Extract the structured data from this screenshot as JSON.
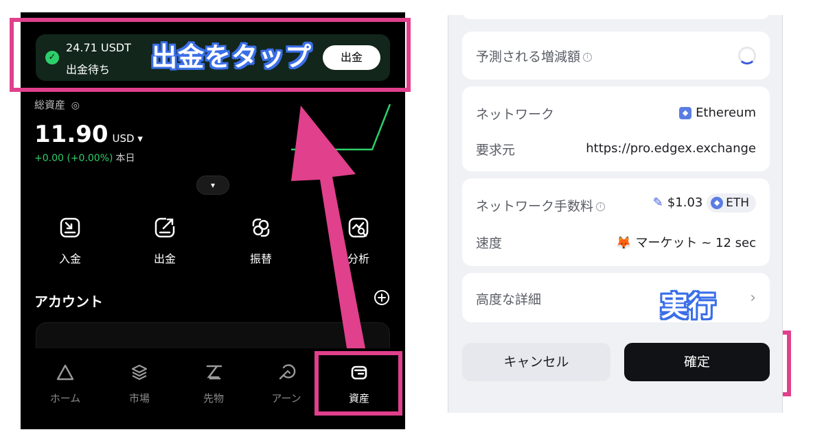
{
  "left": {
    "pending": {
      "amount": "24.71 USDT",
      "status": "出金待ち",
      "withdraw_button": "出金"
    },
    "caption_tap": "出金をタップ",
    "assets": {
      "label": "総資産",
      "total": "11.90",
      "currency": "USD ▾",
      "change": "+0.00 (+0.00%)",
      "period": "本日",
      "expand": "▾"
    },
    "actions": [
      {
        "label": "入金",
        "icon": "deposit-icon"
      },
      {
        "label": "出金",
        "icon": "withdraw-icon"
      },
      {
        "label": "振替",
        "icon": "transfer-icon"
      },
      {
        "label": "分析",
        "icon": "analysis-icon"
      }
    ],
    "account": {
      "title": "アカウント"
    },
    "tabs": [
      {
        "label": "ホーム",
        "icon": "home-icon"
      },
      {
        "label": "市場",
        "icon": "market-icon"
      },
      {
        "label": "先物",
        "icon": "futures-icon"
      },
      {
        "label": "アーン",
        "icon": "earn-icon"
      },
      {
        "label": "資産",
        "icon": "assets-icon",
        "active": true
      }
    ]
  },
  "right": {
    "estimated": {
      "label": "予測される増減額"
    },
    "network": {
      "label": "ネットワーク",
      "value": "Ethereum",
      "requester_label": "要求元",
      "requester_value": "https://pro.edgex.exchange"
    },
    "fee": {
      "label": "ネットワーク手数料",
      "amount": "$1.03",
      "token": "ETH",
      "speed_label": "速度",
      "speed_value": "マーケット ~ 12 sec",
      "speed_emoji": "🦊"
    },
    "advanced": {
      "label": "高度な詳細"
    },
    "caption_exec": "実行",
    "cancel_button": "キャンセル",
    "confirm_button": "確定"
  },
  "colors": {
    "highlight": "#e0408c",
    "caption_outline": "#3a6ee8",
    "positive": "#2ecf6a"
  }
}
